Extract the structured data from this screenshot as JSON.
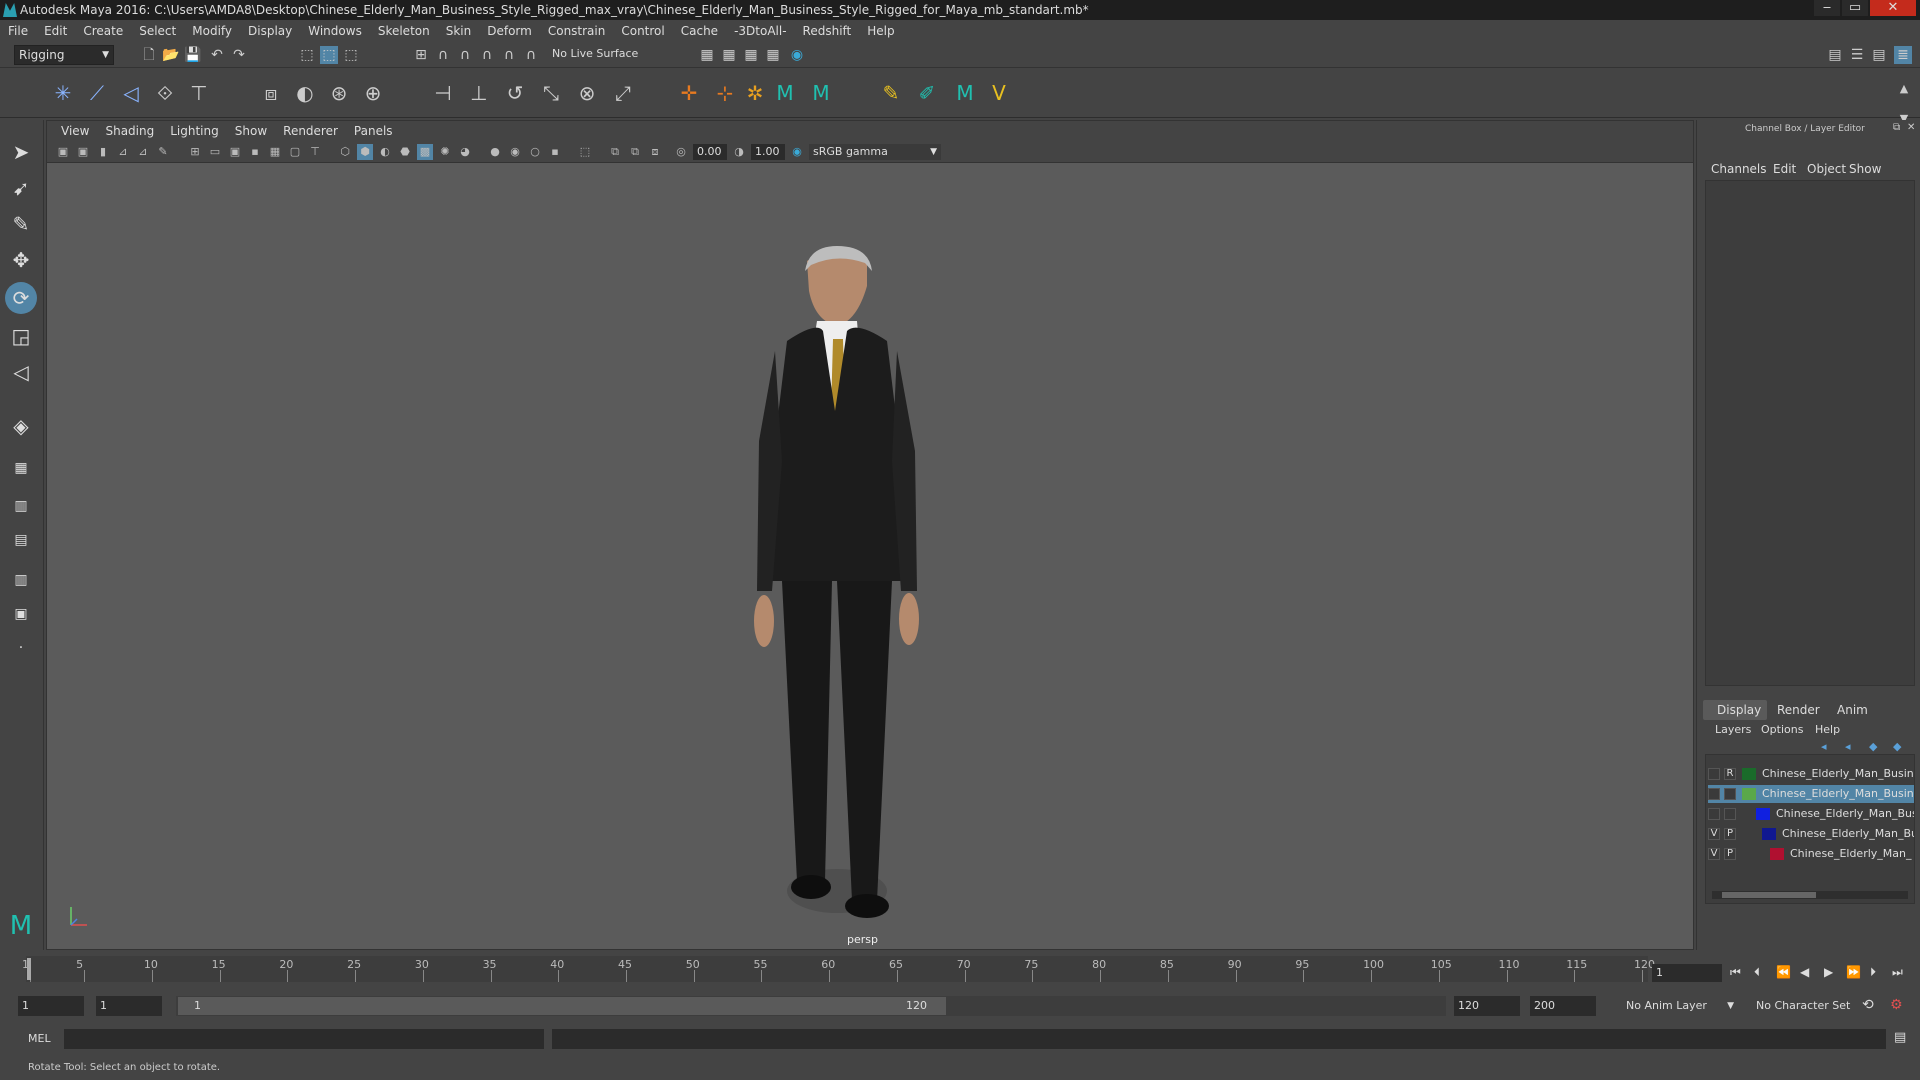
{
  "window": {
    "title": "Autodesk Maya 2016: C:\\Users\\AMDA8\\Desktop\\Chinese_Elderly_Man_Business_Style_Rigged_max_vray\\Chinese_Elderly_Man_Business_Style_Rigged_for_Maya_mb_standart.mb*",
    "minimize": "‒",
    "maximize": "▭",
    "close": "✕"
  },
  "menu": [
    "File",
    "Edit",
    "Create",
    "Select",
    "Modify",
    "Display",
    "Windows",
    "Skeleton",
    "Skin",
    "Deform",
    "Constrain",
    "Control",
    "Cache",
    "-3DtoAll-",
    "Redshift",
    "Help"
  ],
  "status": {
    "mode": "Rigging",
    "live_surface": "No Live Surface"
  },
  "viewport": {
    "menus": [
      "View",
      "Shading",
      "Lighting",
      "Show",
      "Renderer",
      "Panels"
    ],
    "exposure": "0.00",
    "gamma": "1.00",
    "color_space": "sRGB gamma",
    "camera_label": "persp"
  },
  "channelbox": {
    "title": "Channel Box / Layer Editor",
    "tabs": [
      "Channels",
      "Edit",
      "Object",
      "Show"
    ],
    "layer_tabs": [
      "Display",
      "Render",
      "Anim"
    ],
    "layer_menus": [
      "Layers",
      "Options",
      "Help"
    ],
    "layers": [
      {
        "v": "",
        "p": "R",
        "name": "Chinese_Elderly_Man_Busine",
        "color": "#1a6b2a",
        "selected": false
      },
      {
        "v": "",
        "p": "",
        "name": "Chinese_Elderly_Man_Busine",
        "color": "#5aa84a",
        "selected": true
      },
      {
        "v": "",
        "p": "",
        "name": "Chinese_Elderly_Man_Bus",
        "color": "#1020e0",
        "selected": false
      },
      {
        "v": "V",
        "p": "P",
        "name": "Chinese_Elderly_Man_Bu",
        "color": "#101890",
        "selected": false
      },
      {
        "v": "V",
        "p": "P",
        "name": "Chinese_Elderly_Man_",
        "color": "#b01030",
        "selected": false
      }
    ]
  },
  "timeline": {
    "labels": [
      "1",
      "5",
      "10",
      "15",
      "20",
      "25",
      "30",
      "35",
      "40",
      "45",
      "50",
      "55",
      "60",
      "65",
      "70",
      "75",
      "80",
      "85",
      "90",
      "95",
      "100",
      "105",
      "110",
      "115",
      "120"
    ],
    "current_frame": "1"
  },
  "range": {
    "start": "1",
    "playback_start": "1",
    "slider_start": "1",
    "slider_end": "120",
    "playback_end": "120",
    "end": "200",
    "anim_layer": "No Anim Layer",
    "character_set": "No Character Set"
  },
  "cmd": {
    "label": "MEL"
  },
  "help": {
    "text": "Rotate Tool: Select an object to rotate."
  }
}
